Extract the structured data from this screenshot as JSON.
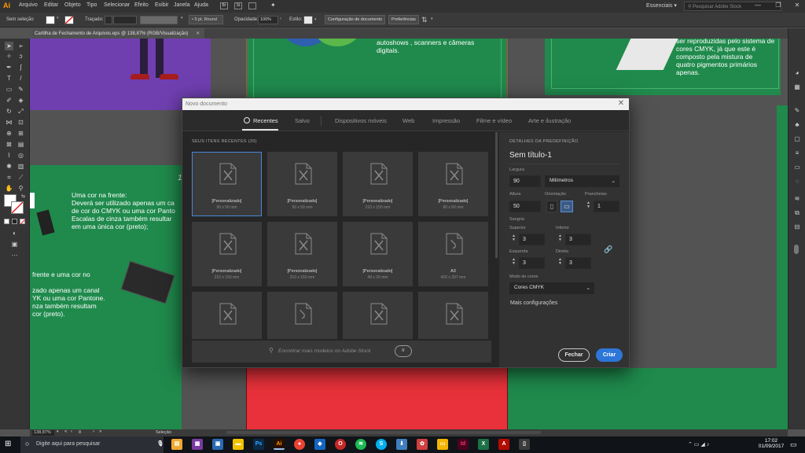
{
  "app": {
    "logo": "Ai"
  },
  "menubar": {
    "items": [
      "Arquivo",
      "Editar",
      "Objeto",
      "Tipo",
      "Selecionar",
      "Efeito",
      "Exibir",
      "Janela",
      "Ajuda"
    ],
    "workspace": "Essenciais",
    "stock_search_placeholder": "Pesquisar Adobe Stock"
  },
  "controlbar": {
    "selection": "Sem seleção",
    "stroke_label": "Traçado:",
    "brush": "5 pt. Round",
    "opacity_label": "Opacidade:",
    "opacity_value": "100%",
    "style_label": "Estilo:",
    "doc_setup_btn": "Configuração de documento",
    "prefs_btn": "Preferências"
  },
  "document": {
    "tab_title": "Cartilha de Fechamento de Arquivos.eps @ 138,87% (RGB/Visualização)"
  },
  "artwork": {
    "top_mid_text": [
      "autoshows , scanners e câmeras",
      "digitais."
    ],
    "top_right_text": [
      "ser reproduzidas pelo sistema de",
      "cores CMYK, já que este é",
      "composto pela mistura de",
      "quatro pigmentos primários",
      "apenas."
    ],
    "left_text_1": [
      "Uma cor  na frente:",
      "Deverá ser utilizado apenas um ca",
      "de cor do CMYK ou uma cor Panto",
      "Escalas de cinza também resultar",
      "em uma única cor (preto);"
    ],
    "left_text_2": [
      "frente  e  uma  cor  no",
      "",
      "zado apenas um canal",
      "YK ou uma cor Pantone.",
      "nza  também  resultam",
      "cor (preto)."
    ],
    "partial_number": "1"
  },
  "statusbar": {
    "zoom": "138,87%",
    "page": "8",
    "mode": "Seleção"
  },
  "dialog": {
    "title": "Novo documento",
    "tabs": [
      "Recentes",
      "Salvo",
      "Dispositivos móveis",
      "Web",
      "Impressão",
      "Filme e vídeo",
      "Arte e ilustração"
    ],
    "active_tab": "Recentes",
    "section_title": "SEUS ITENS RECENTES",
    "section_count": "(20)",
    "cards": [
      {
        "label": "[Personalizado]",
        "size": "90 x 50 mm",
        "icon": "document-x-icon"
      },
      {
        "label": "[Personalizado]",
        "size": "50 x 50 mm",
        "icon": "document-x-icon"
      },
      {
        "label": "[Personalizado]",
        "size": "210 x 150 mm",
        "icon": "document-x-icon"
      },
      {
        "label": "[Personalizado]",
        "size": "90 x 50 mm",
        "icon": "document-x-icon"
      },
      {
        "label": "[Personalizado]",
        "size": "210 x 150 mm",
        "icon": "document-x-icon"
      },
      {
        "label": "[Personalizado]",
        "size": "210 x 150 mm",
        "icon": "document-x-icon"
      },
      {
        "label": "[Personalizado]",
        "size": "49 x 20 mm",
        "icon": "document-x-icon"
      },
      {
        "label": "A3",
        "size": "420 x 297 mm",
        "icon": "document-brush-icon"
      },
      {
        "label": "",
        "size": "",
        "icon": "document-x-icon"
      },
      {
        "label": "",
        "size": "",
        "icon": "document-brush-icon"
      },
      {
        "label": "",
        "size": "",
        "icon": "document-x-icon"
      },
      {
        "label": "",
        "size": "",
        "icon": "document-x-icon"
      }
    ],
    "search_placeholder": "Encontrar mais modelos no Adobe Stock",
    "search_go": "Ir",
    "details": {
      "heading": "DETALHES DA PREDEFINIÇÃO",
      "doc_name": "Sem título-1",
      "width_label": "Largura",
      "width_value": "90",
      "units": "Milímetros",
      "height_label": "Altura",
      "height_value": "50",
      "orientation_label": "Orientação",
      "artboards_label": "Pranchetas",
      "artboards_value": "1",
      "bleed_label": "Sangria",
      "top_label": "Superior",
      "top_value": "3",
      "bottom_label": "Inferior",
      "bottom_value": "3",
      "left_label": "Esquerda",
      "left_value": "3",
      "right_label": "Direita",
      "right_value": "3",
      "color_mode_label": "Modo de cores",
      "color_mode_value": "Cores CMYK",
      "more_settings": "Mais configurações",
      "close_btn": "Fechar",
      "create_btn": "Criar"
    }
  },
  "taskbar": {
    "search_placeholder": "Digite aqui para pesquisar",
    "time": "17:02",
    "date": "01/09/2017"
  },
  "colors": {
    "accent": "#2d76d9",
    "green_page": "#1f8a4c",
    "purple_page": "#6f3fb0",
    "red_page": "#e8313a"
  }
}
